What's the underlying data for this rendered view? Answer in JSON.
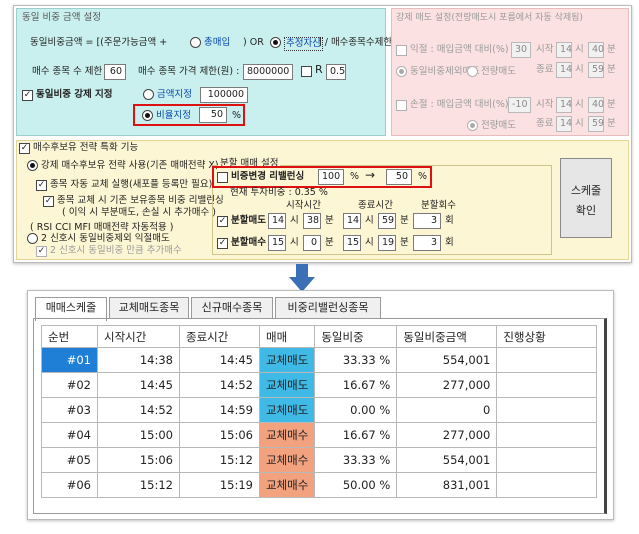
{
  "top": {
    "section1": {
      "title": "동일 비중 금액 설정",
      "amount_label": "동일비중금액 = [(주문가능금액 +",
      "opt_total_buy": "총매입",
      "or_text": ") OR",
      "opt_est_asset": "추정자산",
      "div_text": "] / 매수종목수제한",
      "buy_limit_label": "매수 종목 수 제한 :",
      "buy_limit_value": "60",
      "price_limit_label": "매수 종목 가격 제한(원) :",
      "price_limit_value": "8000000",
      "r_label": "R",
      "r_value": "0.5",
      "force_label": "동일비중 강제 지정",
      "amount_fixed_label": "금액지정",
      "amount_fixed_value": "100000",
      "ratio_fixed_label": "비율지정",
      "ratio_fixed_value": "50",
      "ratio_unit": "%"
    },
    "section2": {
      "title": "강제 매도 설정(전량매도시 포름에서 자동 삭제됨)",
      "profit_label": "익절 : 매입금액 대비(%)",
      "profit_value": "30",
      "start_label": "시작",
      "start_h": "14",
      "start_h_unit": "시",
      "start_m": "40",
      "start_m_unit": "분",
      "opt_equal_sell": "동일비중제외매도",
      "opt_all_sell": "전량매도",
      "end_label": "종료",
      "end_h": "14",
      "end_h_unit": "시",
      "end_m": "59",
      "end_m_unit": "분",
      "loss_label": "손절 : 매입금액 대비(%)",
      "loss_value": "-10",
      "loss_start_label": "시작",
      "loss_h": "14",
      "loss_h_unit": "시",
      "loss_m": "40",
      "loss_m_unit": "분",
      "loss_all_sell": "전량매도",
      "loss_end_label": "종료",
      "loss_end_h": "14",
      "loss_end_h_unit": "시",
      "loss_end_m": "59",
      "loss_end_m_unit": "분"
    },
    "section3": {
      "title": "매수후보유 전략 특화 기능",
      "opt_swap": "강제 매수후보유 전략 사용(기존 매매전략 X)",
      "opt_auto_swap": "종목 자동 교체 실행(새포플 등록만 필요)",
      "opt_rebalance": "종목 교체 시 기존 보유종목 비중 리밸런싱",
      "rebalance_note": "( 이익 시 부분매도, 손실 시 추가매수 )",
      "rsi_note": "( RSI CCI MFI 매매전략 자동적용 )",
      "opt_sig2": "2 신호시 동일비중제외 익절매도",
      "opt_sig2b": "2 신호시 동일비중 만큼 추가매수",
      "split_title": "분할 매매 설정",
      "rebal_label": "비중변경 리밸런싱",
      "rebal_from": "100",
      "rebal_unit1": "%",
      "arrow": "→",
      "rebal_to": "50",
      "rebal_unit2": "%",
      "current_ratio": "현재 투자비중 : 0.35 %",
      "col_start": "시작시간",
      "col_end": "종료시간",
      "col_count": "분할회수",
      "split_sell_label": "분할매도",
      "ss_h1": "14",
      "ss_u1": "시",
      "ss_m1": "38",
      "ss_u2": "분",
      "ss_h2": "14",
      "ss_u3": "시",
      "ss_m2": "59",
      "ss_u4": "분",
      "ss_cnt": "3",
      "ss_cnt_unit": "회",
      "split_buy_label": "분할매수",
      "sb_h1": "15",
      "sb_u1": "시",
      "sb_m1": "0",
      "sb_u2": "분",
      "sb_h2": "15",
      "sb_u3": "시",
      "sb_m2": "19",
      "sb_u4": "분",
      "sb_cnt": "3",
      "sb_cnt_unit": "회",
      "schedule_btn_line1": "스케줄",
      "schedule_btn_line2": "확인"
    }
  },
  "tabs": [
    "매매스케줄",
    "교체매도종목",
    "신규매수종목",
    "비중리밸런싱종목"
  ],
  "table": {
    "headers": [
      "순번",
      "시작시간",
      "종료시간",
      "매매",
      "동일비중",
      "동일비중금액",
      "진행상황"
    ],
    "rows": [
      [
        "#01",
        "14:38",
        "14:45",
        "교체매도",
        "33.33 %",
        "554,001",
        ""
      ],
      [
        "#02",
        "14:45",
        "14:52",
        "교체매도",
        "16.67 %",
        "277,000",
        ""
      ],
      [
        "#03",
        "14:52",
        "14:59",
        "교체매도",
        "0.00 %",
        "0",
        ""
      ],
      [
        "#04",
        "15:00",
        "15:06",
        "교체매수",
        "16.67 %",
        "277,000",
        ""
      ],
      [
        "#05",
        "15:06",
        "15:12",
        "교체매수",
        "33.33 %",
        "554,001",
        ""
      ],
      [
        "#06",
        "15:12",
        "15:19",
        "교체매수",
        "50.00 %",
        "831,001",
        ""
      ]
    ]
  },
  "colors": {
    "sell": "#3fb9e6",
    "buy": "#f2a27e",
    "selected": "#1f7fd6",
    "highlight": "#d11"
  }
}
